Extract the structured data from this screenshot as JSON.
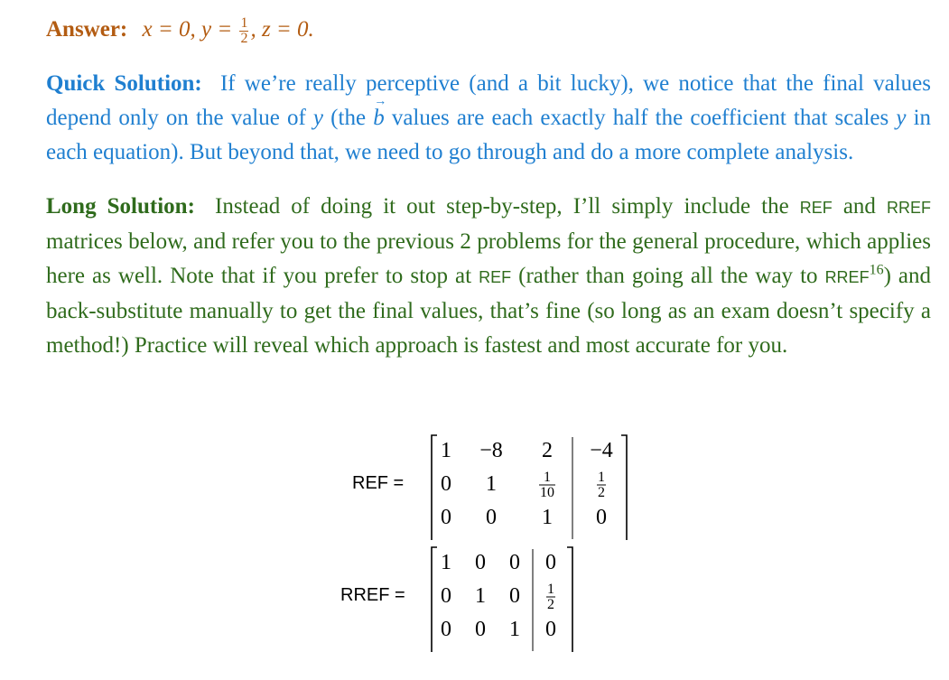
{
  "answer": {
    "label": "Answer:",
    "x": "x = 0,",
    "y_prefix": "y =",
    "y_num": "1",
    "y_den": "2",
    "z": ", z = 0."
  },
  "quick": {
    "label": "Quick Solution:",
    "t1": "If we’re really perceptive (and a bit lucky), we notice that the final values depend only on the value of",
    "var_y": "y",
    "t2": "(the",
    "vec_b": "b",
    "t3": "values are each exactly half the coefficient that scales",
    "var_y2": "y",
    "t4": "in each equation). But beyond that, we need to go through and do a more complete analysis."
  },
  "long": {
    "label": "Long Solution:",
    "t1": "Instead of doing it out step-by-step, I’ll simply include the",
    "ref1": "REF",
    "t2": "and",
    "rref1": "RREF",
    "t3": "matrices below, and refer you to the previous 2 problems for the general procedure, which applies here as well. Note that if you prefer to stop at",
    "ref2": "REF",
    "t4": "(rather than going all the way to",
    "rref2": "RREF",
    "footnote": "16",
    "t5": ") and back-substitute manually to get the final values, that’s fine (so long as an exam doesn’t specify a method!) Practice will reveal which approach is fastest and most accurate for you."
  },
  "ref_matrix": {
    "label": "REF =",
    "rows": [
      [
        "1",
        "−8",
        "2",
        "−4"
      ],
      [
        "0",
        "1",
        "1/10",
        "1/2"
      ],
      [
        "0",
        "0",
        "1",
        "0"
      ]
    ]
  },
  "rref_matrix": {
    "label": "RREF =",
    "rows": [
      [
        "1",
        "0",
        "0",
        "0"
      ],
      [
        "0",
        "1",
        "0",
        "1/2"
      ],
      [
        "0",
        "0",
        "1",
        "0"
      ]
    ]
  }
}
